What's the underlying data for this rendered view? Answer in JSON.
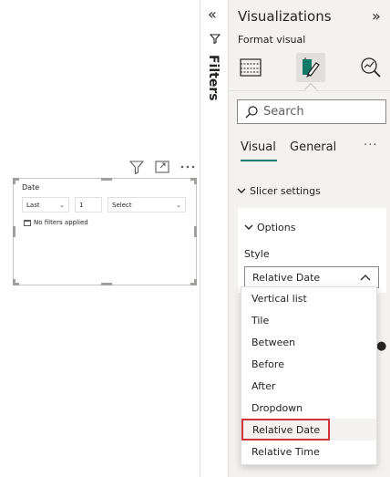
{
  "canvas": {
    "slicer": {
      "title": "Date",
      "period_select": "Last",
      "count_value": "1",
      "unit_select": "Select",
      "empty_message": "No filters applied"
    }
  },
  "filters_pane": {
    "label": "Filters"
  },
  "viz_pane": {
    "title": "Visualizations",
    "subtitle": "Format visual",
    "search_placeholder": "Search",
    "tabs": {
      "visual": "Visual",
      "general": "General",
      "more": "···"
    },
    "section": "Slicer settings",
    "options_card": {
      "title": "Options",
      "style_label": "Style",
      "style_value": "Relative Date"
    }
  },
  "style_dropdown": {
    "options": [
      "Vertical list",
      "Tile",
      "Between",
      "Before",
      "After",
      "Dropdown",
      "Relative Date",
      "Relative Time"
    ],
    "selected": "Relative Date"
  },
  "colors": {
    "accent": "#117865",
    "highlight_border": "#d13438"
  }
}
